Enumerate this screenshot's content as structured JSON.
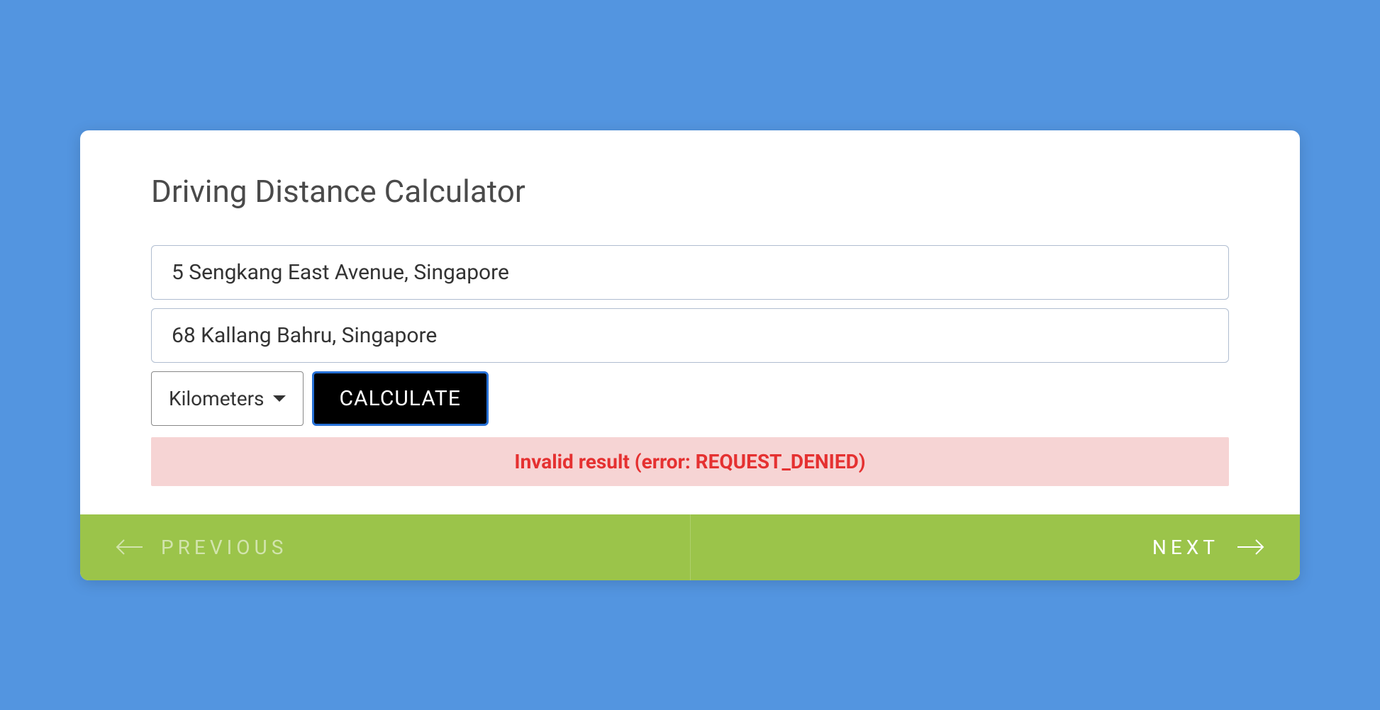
{
  "header": {
    "title": "Driving Distance Calculator"
  },
  "form": {
    "origin_value": "5 Sengkang East Avenue, Singapore",
    "destination_value": "68 Kallang Bahru, Singapore",
    "unit_selected": "Kilometers",
    "calculate_label": "CALCULATE"
  },
  "error": {
    "message": "Invalid result (error: REQUEST_DENIED)"
  },
  "nav": {
    "previous_label": "PREVIOUS",
    "next_label": "NEXT"
  },
  "colors": {
    "background": "#5395e0",
    "footer": "#9bc44a",
    "error_bg": "#f6d4d4",
    "error_text": "#e53131"
  }
}
